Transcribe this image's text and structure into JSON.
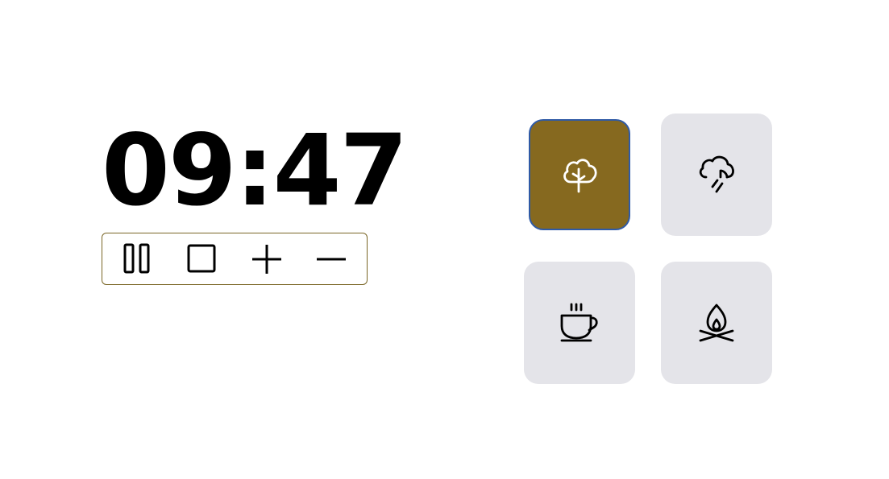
{
  "timer": {
    "time": "09:47"
  },
  "controls": [
    {
      "id": "pause",
      "icon": "pause-icon"
    },
    {
      "id": "stop",
      "icon": "stop-icon"
    },
    {
      "id": "increase",
      "icon": "plus-icon"
    },
    {
      "id": "decrease",
      "icon": "minus-icon"
    }
  ],
  "sounds": [
    {
      "id": "forest",
      "icon": "tree-icon",
      "selected": true
    },
    {
      "id": "rain",
      "icon": "rain-cloud-icon",
      "selected": false
    },
    {
      "id": "cafe",
      "icon": "coffee-cup-icon",
      "selected": false
    },
    {
      "id": "fireplace",
      "icon": "campfire-icon",
      "selected": false
    }
  ],
  "colors": {
    "accent": "#86691f",
    "selected_border": "#2f5aa6",
    "tile_background": "#e4e4e9",
    "controls_border": "#7a6626"
  }
}
